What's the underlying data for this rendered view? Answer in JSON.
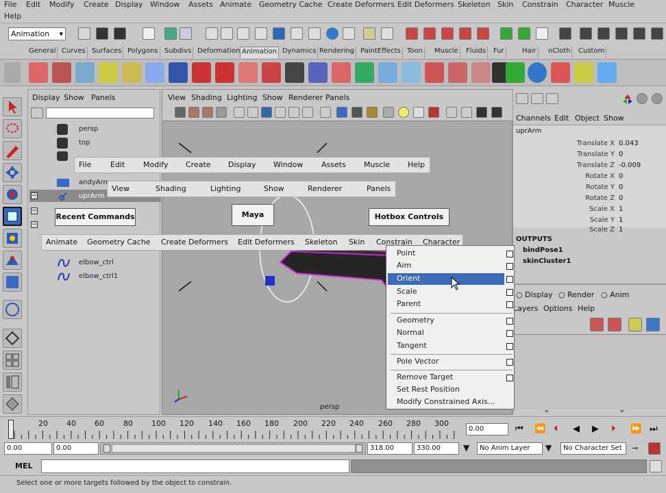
{
  "menubar": [
    "File",
    "Edit",
    "Modify",
    "Create",
    "Display",
    "Window",
    "Assets",
    "Animate",
    "Geometry Cache",
    "Create Deformers",
    "Edit Deformers",
    "Skeleton",
    "Skin",
    "Constrain",
    "Character",
    "Muscle",
    "Help"
  ],
  "statusline": {
    "mode": "Animation"
  },
  "shelf_tabs": [
    "General",
    "Curves",
    "Surfaces",
    "Polygons",
    "Subdivs",
    "Deformation",
    "Animation",
    "Dynamics",
    "Rendering",
    "PaintEffects",
    "Toon",
    "Muscle",
    "Fluids",
    "Fur",
    "Hair",
    "nCloth",
    "Custom"
  ],
  "outliner": {
    "menus": [
      "Display",
      "Show",
      "Panels"
    ],
    "items": [
      "persp",
      "top",
      "front",
      "andyArm",
      "uprArm",
      "elbow_ctrl",
      "elbow_ctrl1"
    ]
  },
  "viewport": {
    "menus": [
      "View",
      "Shading",
      "Lighting",
      "Show",
      "Renderer",
      "Panels"
    ],
    "camera_label": "persp"
  },
  "channel_box": {
    "menus": [
      "Channels",
      "Edit",
      "Object",
      "Show"
    ],
    "object": "uprArm",
    "channels": [
      {
        "label": "Translate X",
        "value": "0.043"
      },
      {
        "label": "Translate Y",
        "value": "0"
      },
      {
        "label": "Translate Z",
        "value": "-0.009"
      },
      {
        "label": "Rotate X",
        "value": "0"
      },
      {
        "label": "Rotate Y",
        "value": "0"
      },
      {
        "label": "Rotate Z",
        "value": "0"
      },
      {
        "label": "Scale X",
        "value": "1"
      },
      {
        "label": "Scale Y",
        "value": "1"
      },
      {
        "label": "Scale Z",
        "value": "1"
      }
    ],
    "outputs_label": "OUTPUTS",
    "outputs": [
      "bindPose1",
      "skinCluster1"
    ],
    "layer_radios": [
      "Display",
      "Render",
      "Anim"
    ],
    "layer_menus": [
      "Layers",
      "Options",
      "Help"
    ]
  },
  "hotbox": {
    "row1": [
      "File",
      "Edit",
      "Modify",
      "Create",
      "Display",
      "Window",
      "Assets",
      "Muscle",
      "Help"
    ],
    "row2": [
      "View",
      "Shading",
      "Lighting",
      "Show",
      "Renderer",
      "Panels"
    ],
    "recent": "Recent Commands",
    "center": "Maya",
    "controls": "Hotbox Controls",
    "row4": [
      "Animate",
      "Geometry Cache",
      "Create Deformers",
      "Edit Deformers",
      "Skeleton",
      "Skin",
      "Constrain",
      "Character"
    ]
  },
  "constrain_menu": {
    "group1": [
      "Point",
      "Aim",
      "Orient",
      "Scale",
      "Parent"
    ],
    "group2": [
      "Geometry",
      "Normal",
      "Tangent"
    ],
    "group3": [
      "Pole Vector"
    ],
    "group4": [
      "Remove Target",
      "Set Rest Position",
      "Modify Constrained Axis..."
    ],
    "highlighted": "Orient",
    "highlight_color": "#3e6bb8"
  },
  "timeline": {
    "ticks": [
      "20",
      "40",
      "60",
      "80",
      "100",
      "120",
      "140",
      "160",
      "180",
      "200",
      "220",
      "240",
      "260",
      "280",
      "300"
    ],
    "current_time": "0.00"
  },
  "range": {
    "start": "0.00",
    "playback_start": "0.00",
    "playback_end": "318.00",
    "end": "330.00",
    "anim_layer": "No Anim Layer",
    "character_set": "No Character Set"
  },
  "cmdline": {
    "label": "MEL"
  },
  "status": {
    "help": "Select one or more targets followed by the object to constrain."
  }
}
